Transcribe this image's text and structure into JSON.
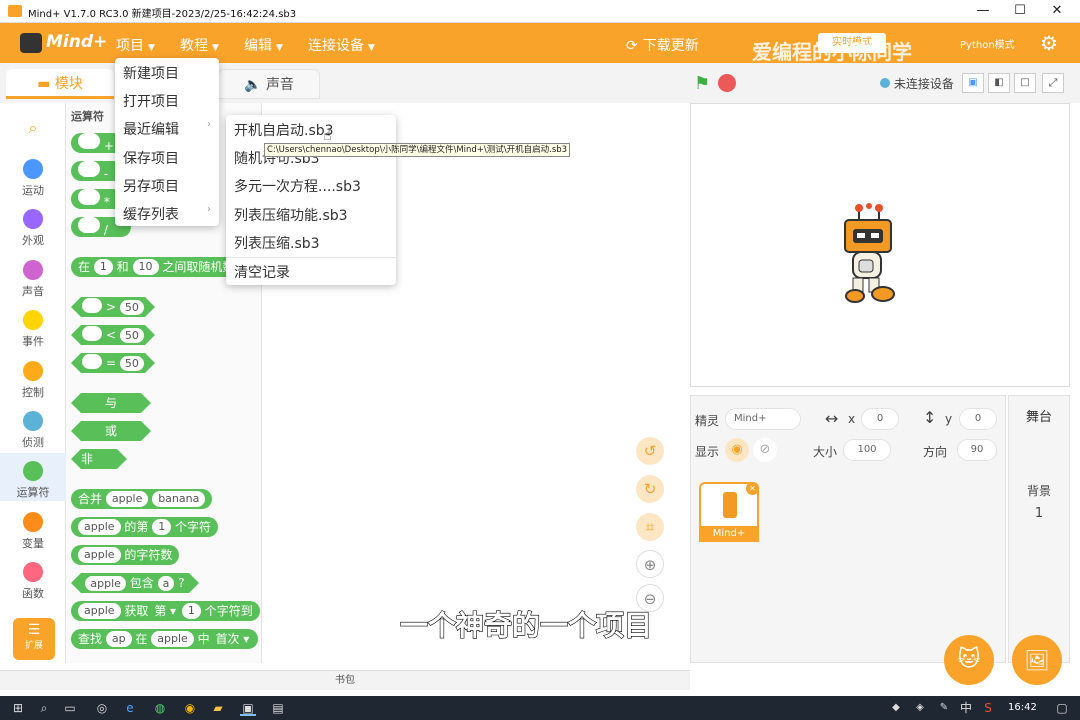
{
  "window": {
    "title": "Mind+ V1.7.0 RC3.0   新建项目-2023/2/25-16:42:24.sb3",
    "minimize": "—",
    "maximize": "☐",
    "close": "✕"
  },
  "menubar": {
    "logo": "Mind+",
    "items": [
      {
        "label": "项目"
      },
      {
        "label": "教程"
      },
      {
        "label": "编辑"
      },
      {
        "label": "连接设备"
      }
    ],
    "download": "下载更新",
    "overlay_badge": "实时模式",
    "python_label": "Python模式"
  },
  "watermark": "爱编程的小陈同学",
  "tabs": {
    "blocks": "模块",
    "sound": "声音"
  },
  "categories": [
    {
      "label": "",
      "color": "#f9a32b"
    },
    {
      "label": "运动",
      "color": "#4c97ff"
    },
    {
      "label": "外观",
      "color": "#9966ff"
    },
    {
      "label": "声音",
      "color": "#cf63cf"
    },
    {
      "label": "事件",
      "color": "#ffd500"
    },
    {
      "label": "控制",
      "color": "#ffab19"
    },
    {
      "label": "侦测",
      "color": "#5cb1d6"
    },
    {
      "label": "运算符",
      "color": "#59c059"
    },
    {
      "label": "变量",
      "color": "#ff8c1a"
    },
    {
      "label": "函数",
      "color": "#ff6680"
    }
  ],
  "extension_label": "扩展",
  "palette": {
    "section_title": "运算符",
    "math_ops": [
      "+",
      "-",
      "*",
      "/"
    ],
    "random": {
      "prefix": "在",
      "a": "1",
      "mid": "和",
      "b": "10",
      "suffix": "之间取随机数"
    },
    "compare": [
      {
        "op": ">",
        "v": "50"
      },
      {
        "op": "<",
        "v": "50"
      },
      {
        "op": "=",
        "v": "50"
      }
    ],
    "logic": [
      "与",
      "或",
      "非"
    ],
    "join": {
      "label": "合并",
      "a": "apple",
      "b": "banana"
    },
    "letter_of": {
      "s": "apple",
      "mid": "的第",
      "n": "1",
      "suffix": "个字符"
    },
    "length_of": {
      "s": "apple",
      "suffix": "的字符数"
    },
    "contains": {
      "s": "apple",
      "mid": "包含",
      "c": "a",
      "q": "?"
    },
    "substring": {
      "s": "apple",
      "mid": "获取",
      "dd": "第 ▾",
      "n": "1",
      "suffix": "个字符到"
    },
    "find": {
      "label": "查找",
      "a": "ap",
      "mid": "在",
      "s": "apple",
      "mid2": "中",
      "dd": "首次 ▾"
    }
  },
  "project_menu": {
    "items": [
      "新建项目",
      "打开项目",
      "最近编辑",
      "保存项目",
      "另存项目",
      "缓存列表"
    ]
  },
  "recent_menu": {
    "items": [
      "开机自启动.sb3",
      "随机诗句.sb3",
      "多元一次方程....sb3",
      "列表压缩功能.sb3",
      "列表压缩.sb3"
    ],
    "clear": "清空记录"
  },
  "tooltip": "C:\\Users\\chennao\\Desktop\\小陈同学\\编程文件\\Mind+\\测试\\开机自启动.sb3",
  "stage_bar": {
    "connection": "未连接设备"
  },
  "sprite_panel": {
    "sprite_label": "精灵",
    "sprite_name": "Mind+",
    "x_label": "x",
    "x": "0",
    "y_label": "y",
    "y": "0",
    "show_label": "显示",
    "size_label": "大小",
    "size": "100",
    "direction_label": "方向",
    "direction": "90",
    "thumb_name": "Mind+"
  },
  "stage_panel": {
    "title": "舞台",
    "backdrop_label": "背景",
    "backdrop_count": "1"
  },
  "bottom_bar": "书包",
  "subtitle": "一个神奇的一个项目",
  "taskbar": {
    "time": "16:42",
    "ime": "中",
    "ime2": "S"
  },
  "colors": {
    "brand": "#f9a32b",
    "operators": "#59c059"
  }
}
